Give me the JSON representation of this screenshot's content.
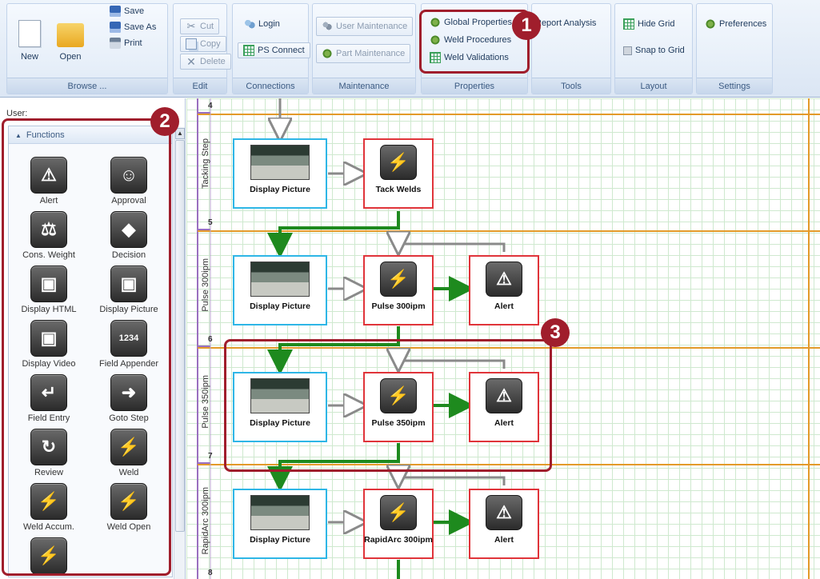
{
  "ribbon": {
    "browse": {
      "new": "New",
      "open": "Open",
      "save": "Save",
      "save_as": "Save As",
      "print": "Print",
      "label": "Browse ..."
    },
    "edit": {
      "cut": "Cut",
      "copy": "Copy",
      "delete": "Delete",
      "label": "Edit"
    },
    "connections": {
      "login": "Login",
      "ps_connect": "PS Connect",
      "label": "Connections"
    },
    "maintenance": {
      "user": "User Maintenance",
      "part": "Part Maintenance",
      "label": "Maintenance"
    },
    "properties": {
      "global": "Global Properties",
      "weld_procedures": "Weld Procedures",
      "weld_validations": "Weld Validations",
      "label": "Properties"
    },
    "tools": {
      "report": "Report Analysis",
      "label": "Tools"
    },
    "layout": {
      "hide_grid": "Hide Grid",
      "snap": "Snap to Grid",
      "label": "Layout"
    },
    "settings": {
      "preferences": "Preferences",
      "label": "Settings"
    }
  },
  "annotations": {
    "one": "1",
    "two": "2",
    "three": "3"
  },
  "left": {
    "user_label": "User:",
    "functions_header": "Functions",
    "functions": [
      {
        "label": "Alert",
        "icon": "⚠"
      },
      {
        "label": "Approval",
        "icon": "☺"
      },
      {
        "label": "Cons. Weight",
        "icon": "⚖"
      },
      {
        "label": "Decision",
        "icon": "◆"
      },
      {
        "label": "Display HTML",
        "icon": "▣"
      },
      {
        "label": "Display Picture",
        "icon": "▣"
      },
      {
        "label": "Display Video",
        "icon": "▣"
      },
      {
        "label": "Field Appender",
        "icon": "1234"
      },
      {
        "label": "Field Entry",
        "icon": "↵"
      },
      {
        "label": "Goto Step",
        "icon": "➜"
      },
      {
        "label": "Review",
        "icon": "↻"
      },
      {
        "label": "Weld",
        "icon": "⚡"
      },
      {
        "label": "Weld Accum.",
        "icon": "⚡"
      },
      {
        "label": "Weld Open",
        "icon": "⚡"
      },
      {
        "label": "",
        "icon": "⚡"
      }
    ]
  },
  "canvas": {
    "lanes": [
      {
        "num": "4",
        "label": ""
      },
      {
        "num": "5",
        "label": "Tacking Step"
      },
      {
        "num": "6",
        "label": "Pulse 300ipm"
      },
      {
        "num": "7",
        "label": "Pulse 350ipm"
      },
      {
        "num": "8",
        "label": "RapidArc 300ipm"
      }
    ],
    "nodes": {
      "r1": {
        "pic": "Display Picture",
        "weld": "Tack Welds"
      },
      "r2": {
        "pic": "Display Picture",
        "weld": "Pulse 300ipm",
        "alert": "Alert"
      },
      "r3": {
        "pic": "Display Picture",
        "weld": "Pulse 350ipm",
        "alert": "Alert"
      },
      "r4": {
        "pic": "Display Picture",
        "weld": "RapidArc 300ipm",
        "alert": "Alert"
      }
    },
    "icons": {
      "weld": "⚡",
      "alert": "⚠"
    }
  }
}
